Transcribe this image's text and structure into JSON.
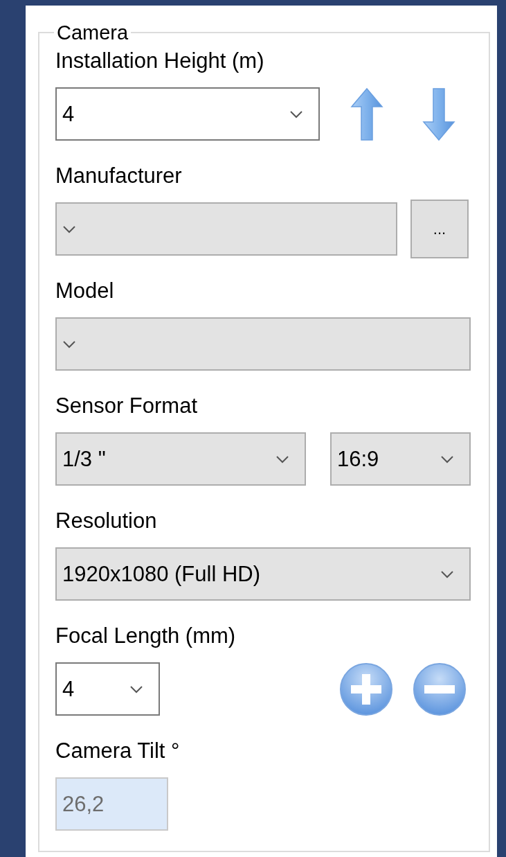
{
  "group": {
    "title": "Camera"
  },
  "fields": [
    {
      "kind": "combo_arrows",
      "label": "Installation Height (m)",
      "value": "4",
      "editable": true
    },
    {
      "kind": "combo_more",
      "label": "Manufacturer",
      "editable": false,
      "button": "..."
    },
    {
      "kind": "combo",
      "label": "Model",
      "editable": false
    },
    {
      "kind": "combo_pair",
      "label": "Sensor Format",
      "value": "1/3 \"",
      "editable": false,
      "value_2": "16:9"
    },
    {
      "kind": "combo",
      "label": "Resolution",
      "value": "1920x1080 (Full HD)",
      "editable": false
    },
    {
      "kind": "combo_zoom",
      "label": "Focal Length (mm)",
      "value": "4",
      "editable": true
    },
    {
      "kind": "textbox",
      "label": "Camera Tilt °",
      "value": "26,2",
      "readonly": true
    }
  ]
}
